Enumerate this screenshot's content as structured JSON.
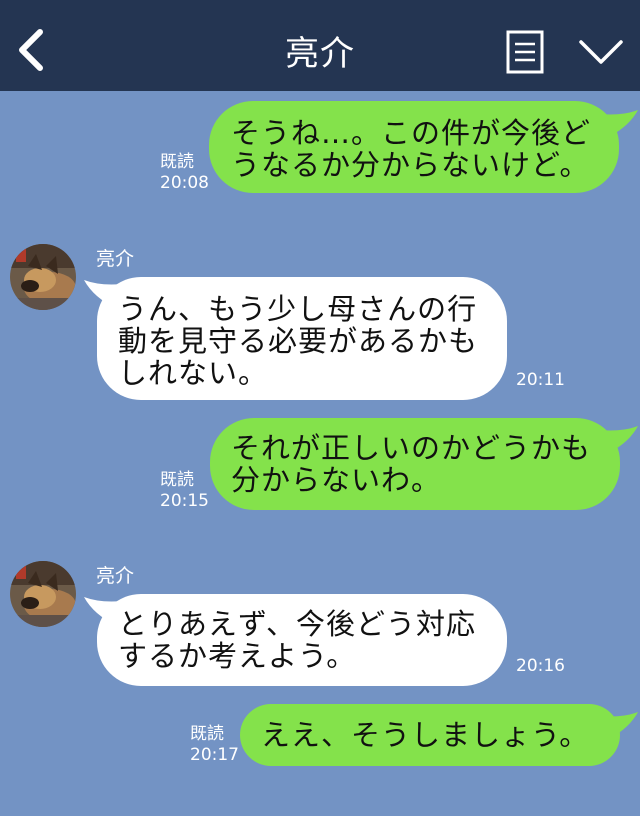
{
  "header": {
    "title": "亮介",
    "back_icon": "chevron-left-icon",
    "memo_icon": "notes-icon",
    "menu_icon": "chevron-down-icon",
    "background": "#243552"
  },
  "colors": {
    "chat_background": "#7393c4",
    "outgoing_bubble": "#84e24b",
    "incoming_bubble": "#ffffff"
  },
  "messages": [
    {
      "direction": "outgoing",
      "lines": [
        "そうね…。この件が今後ど",
        "うなるか分からないけど。"
      ],
      "read_label": "既読",
      "time": "20:08"
    },
    {
      "direction": "incoming",
      "sender": "亮介",
      "lines": [
        "うん、もう少し母さんの行",
        "動を見守る必要があるかも",
        "しれない。"
      ],
      "time": "20:11"
    },
    {
      "direction": "outgoing",
      "lines": [
        "それが正しいのかどうかも",
        "分からないわ。"
      ],
      "read_label": "既読",
      "time": "20:15"
    },
    {
      "direction": "incoming",
      "sender": "亮介",
      "lines": [
        "とりあえず、今後どう対応",
        "するか考えよう。"
      ],
      "time": "20:16"
    },
    {
      "direction": "outgoing",
      "lines": [
        "ええ、そうしましょう。"
      ],
      "read_label": "既読",
      "time": "20:17"
    }
  ]
}
